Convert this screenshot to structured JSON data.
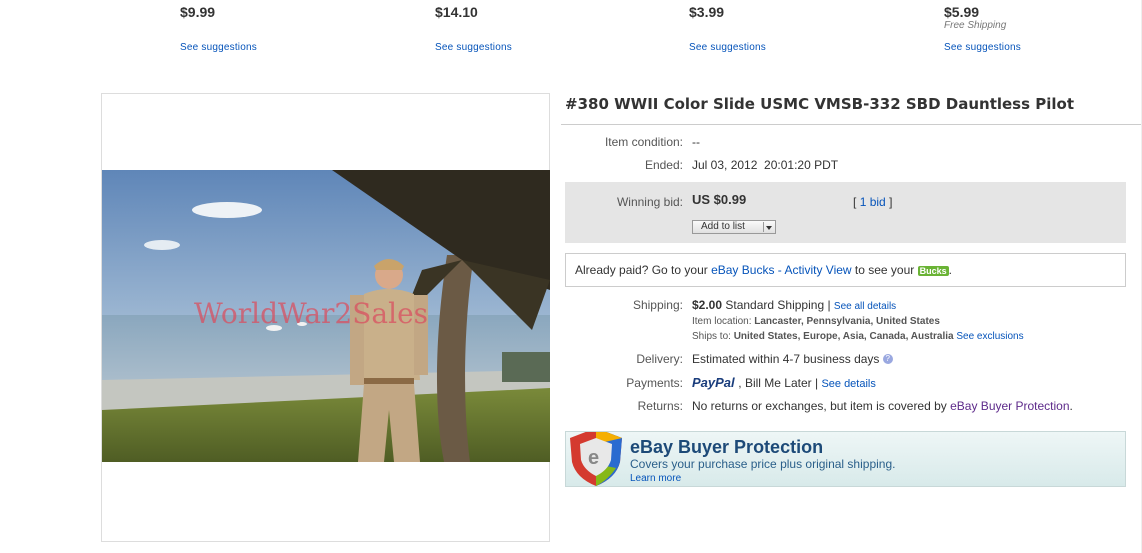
{
  "suggestions": [
    {
      "price": "$9.99",
      "shipping": "",
      "link": "See suggestions"
    },
    {
      "price": "$14.10",
      "shipping": "",
      "link": "See suggestions"
    },
    {
      "price": "$3.99",
      "shipping": "",
      "link": "See suggestions"
    },
    {
      "price": "$5.99",
      "shipping": "Free Shipping",
      "link": "See suggestions"
    }
  ],
  "photo": {
    "watermark": "WorldWar2Sales"
  },
  "item": {
    "title": "#380 WWII Color Slide USMC VMSB-332 SBD Dauntless Pilot",
    "condition_label": "Item condition:",
    "condition_value": "--",
    "ended_label": "Ended:",
    "ended_value": "Jul 03, 2012  20:01:20 PDT",
    "bid_label": "Winning bid:",
    "bid_value": "US $0.99",
    "bid_count_open": "[",
    "bid_count": "1 bid",
    "bid_count_close": "]",
    "add_to_list": "Add to list"
  },
  "paid": {
    "prefix": "Already paid? Go to your ",
    "link": "eBay Bucks - Activity View",
    "suffix": " to see your ",
    "badge": "Bucks",
    "end": "."
  },
  "shipping": {
    "label": "Shipping:",
    "cost": "$2.00",
    "method": "Standard Shipping |",
    "details_link": "See all details",
    "location_label": "Item location:",
    "location_value": "Lancaster, Pennsylvania, United States",
    "ships_label": "Ships to:",
    "ships_value": "United States, Europe, Asia, Canada, Australia",
    "exclusions_link": "See exclusions"
  },
  "delivery": {
    "label": "Delivery:",
    "value": "Estimated within 4-7 business days"
  },
  "payments": {
    "label": "Payments:",
    "paypal": "PayPal",
    "rest": ", Bill Me Later |",
    "details_link": "See details"
  },
  "returns": {
    "label": "Returns:",
    "value": "No returns or exchanges, but item is covered by ",
    "link": "eBay Buyer Protection",
    "end": "."
  },
  "protection": {
    "title": "eBay Buyer Protection",
    "subtitle": "Covers your purchase price plus original shipping.",
    "learn_more": "Learn more"
  },
  "colors": {
    "link": "#0654ba",
    "bid_bg": "#e5e5e5",
    "paypal_dark": "#1a3d7c",
    "paypal_light": "#2a8bd7",
    "bucks_green": "#6ab335"
  }
}
